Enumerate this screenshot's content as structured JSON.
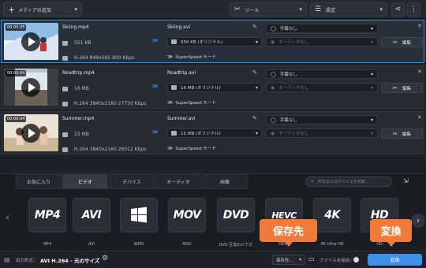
{
  "toolbar": {
    "add_media_label": "メディアの追加",
    "tools_label": "ツール",
    "settings_label": "設定"
  },
  "files": [
    {
      "thumb_time": "00:00:05",
      "src_name": "Skiing.mp4",
      "src_size": "551 KB",
      "src_info": "H.264 849x565 900 Kbps",
      "dst_name": "Skiing.avi",
      "dst_size": "550 KB (オリジナル)",
      "superspeed": "SuperSpeed モード",
      "subtitle": "字幕なし",
      "audio": "オーディオなし",
      "edit_label": "編集",
      "selected": true
    },
    {
      "thumb_time": "00:00:04",
      "src_name": "Roadtrip.mp4",
      "src_size": "16 MB",
      "src_info": "H.264 3840x2160 27750 Kbps",
      "dst_name": "Roadtrip.avi",
      "dst_size": "16 MB (オリジナル)",
      "superspeed": "SuperSpeed モード",
      "subtitle": "字幕なし",
      "audio": "オーディオなし",
      "edit_label": "編集",
      "selected": false
    },
    {
      "thumb_time": "00:00:04",
      "src_name": "Summer.mp4",
      "src_size": "15 MB",
      "src_info": "H.264 3840x2160 26012 Kbps",
      "dst_name": "Summer.avi",
      "dst_size": "15 MB (オリジナル)",
      "superspeed": "SuperSpeed モード",
      "subtitle": "字幕なし",
      "audio": "オーディオなし",
      "edit_label": "編集",
      "selected": false
    }
  ],
  "tabs": [
    {
      "label": "お気に入り",
      "active": false
    },
    {
      "label": "ビデオ",
      "active": true
    },
    {
      "label": "デバイス",
      "active": false
    },
    {
      "label": "オーディオ",
      "active": false
    },
    {
      "label": "画像",
      "active": false
    }
  ],
  "search": {
    "placeholder": "形式またはデバイスを検索..."
  },
  "formats": [
    {
      "logo": "MP4",
      "label": "MP4"
    },
    {
      "logo": "AVI",
      "label": "AVI"
    },
    {
      "logo": "windows-logo-icon",
      "label": "WMV"
    },
    {
      "logo": "MOV",
      "label": "MOV"
    },
    {
      "logo": "DVD",
      "label": "DVD 互換のビデオ"
    },
    {
      "logo": "HEVC",
      "label": "HEVC"
    },
    {
      "logo": "4K",
      "label": "4K Ultra HD"
    },
    {
      "logo": "HD",
      "label": "HD"
    }
  ],
  "bottom": {
    "output_label": "出力形式：",
    "output_value": "AVI H.264 - 元のサイズ",
    "save_to_label": "保存先...",
    "merge_label": "ファイルを結合：",
    "convert_label": "変換"
  },
  "callouts": {
    "save": "保存先",
    "convert": "変換"
  },
  "colors": {
    "accent": "#3d8fe8",
    "callout": "#f07a3a",
    "selection": "#2f8fe0"
  }
}
